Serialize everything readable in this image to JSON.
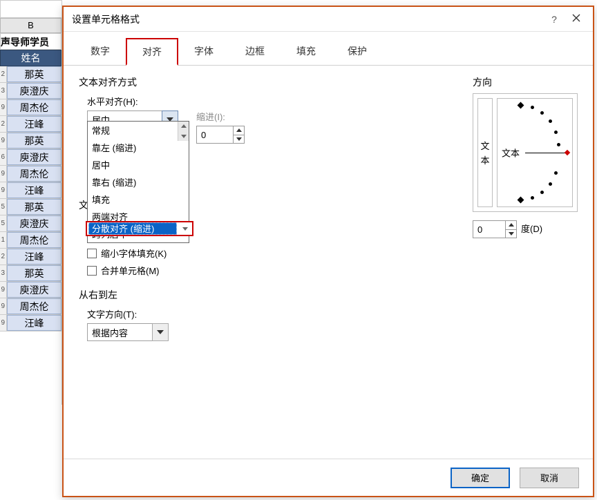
{
  "sheet": {
    "col_letter": "B",
    "title": "声导师学员",
    "header": "姓名",
    "rows": [
      "那英",
      "庾澄庆",
      "周杰伦",
      "汪峰",
      "那英",
      "庾澄庆",
      "周杰伦",
      "汪峰",
      "那英",
      "庾澄庆",
      "周杰伦",
      "汪峰",
      "那英",
      "庾澄庆",
      "周杰伦",
      "汪峰"
    ],
    "rownums": [
      "2",
      "3",
      "9",
      "2",
      "9",
      "6",
      "9",
      "9",
      "5",
      "5",
      "1",
      "2",
      "3",
      "9",
      "9",
      "9"
    ]
  },
  "dialog": {
    "title": "设置单元格格式",
    "help": "?",
    "tabs": [
      "数字",
      "对齐",
      "字体",
      "边框",
      "填充",
      "保护"
    ],
    "active_tab": 1,
    "align": {
      "section": "文本对齐方式",
      "h_label": "水平对齐(H):",
      "h_value": "居中",
      "h_options": [
        "常规",
        "靠左 (缩进)",
        "居中",
        "靠右 (缩进)",
        "填充",
        "两端对齐",
        "跨列居中",
        "分散对齐 (缩进)"
      ],
      "h_selected_index": 7,
      "indent_label": "缩进(I):",
      "indent_value": "0",
      "control_section_prefix": "文",
      "shrink_label": "缩小字体填充(K)",
      "merge_label": "合并单元格(M)"
    },
    "rtl": {
      "section": "从右到左",
      "dir_label": "文字方向(T):",
      "dir_value": "根据内容"
    },
    "orient": {
      "label": "方向",
      "vert": "文本",
      "htext": "文本",
      "deg_value": "0",
      "deg_label": "度(D)"
    },
    "buttons": {
      "ok": "确定",
      "cancel": "取消"
    }
  }
}
